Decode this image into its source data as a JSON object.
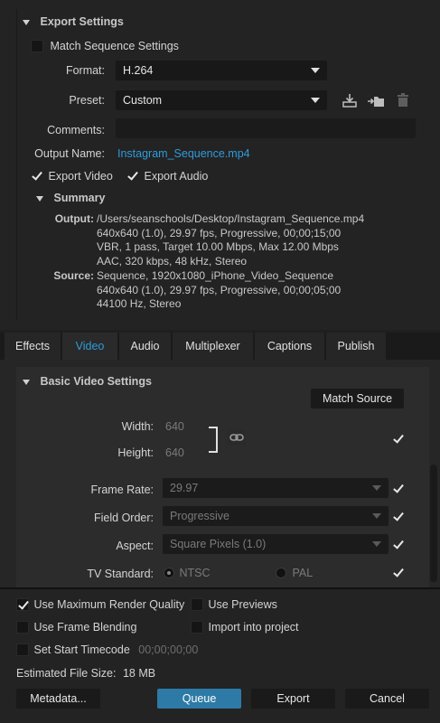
{
  "export_settings": {
    "title": "Export Settings",
    "match_sequence": "Match Sequence Settings",
    "format_label": "Format:",
    "format_value": "H.264",
    "preset_label": "Preset:",
    "preset_value": "Custom",
    "comments_label": "Comments:",
    "comments_value": "",
    "output_name_label": "Output Name:",
    "output_name_value": "Instagram_Sequence.mp4",
    "export_video": "Export Video",
    "export_audio": "Export Audio",
    "summary_title": "Summary",
    "output_label": "Output:",
    "output_text": "/Users/seanschools/Desktop/Instagram_Sequence.mp4\n640x640 (1.0), 29.97 fps, Progressive, 00;00;15;00\nVBR, 1 pass, Target 10.00 Mbps, Max 12.00 Mbps\nAAC, 320 kbps, 48 kHz, Stereo",
    "source_label": "Source:",
    "source_text": "Sequence, 1920x1080_iPhone_Video_Sequence\n640x640 (1.0), 29.97 fps, Progressive, 00;00;05;00\n44100 Hz, Stereo"
  },
  "tabs": [
    {
      "label": "Effects"
    },
    {
      "label": "Video"
    },
    {
      "label": "Audio"
    },
    {
      "label": "Multiplexer"
    },
    {
      "label": "Captions"
    },
    {
      "label": "Publish"
    }
  ],
  "video": {
    "title": "Basic Video Settings",
    "match_source": "Match Source",
    "width_label": "Width:",
    "width_value": "640",
    "height_label": "Height:",
    "height_value": "640",
    "frame_rate_label": "Frame Rate:",
    "frame_rate_value": "29.97",
    "field_order_label": "Field Order:",
    "field_order_value": "Progressive",
    "aspect_label": "Aspect:",
    "aspect_value": "Square Pixels (1.0)",
    "tv_standard_label": "TV Standard:",
    "ntsc": "NTSC",
    "pal": "PAL"
  },
  "bottom": {
    "max_render_quality": "Use Maximum Render Quality",
    "use_previews": "Use Previews",
    "frame_blending": "Use Frame Blending",
    "import_project": "Import into project",
    "set_start_timecode": "Set Start Timecode",
    "start_timecode_value": "00;00;00;00",
    "est_size_label": "Estimated File Size:",
    "est_size_value": "18 MB",
    "metadata": "Metadata...",
    "queue": "Queue",
    "export": "Export",
    "cancel": "Cancel"
  },
  "colors": {
    "accent": "#2d9cdb",
    "queue_button": "#2d7aa6"
  }
}
